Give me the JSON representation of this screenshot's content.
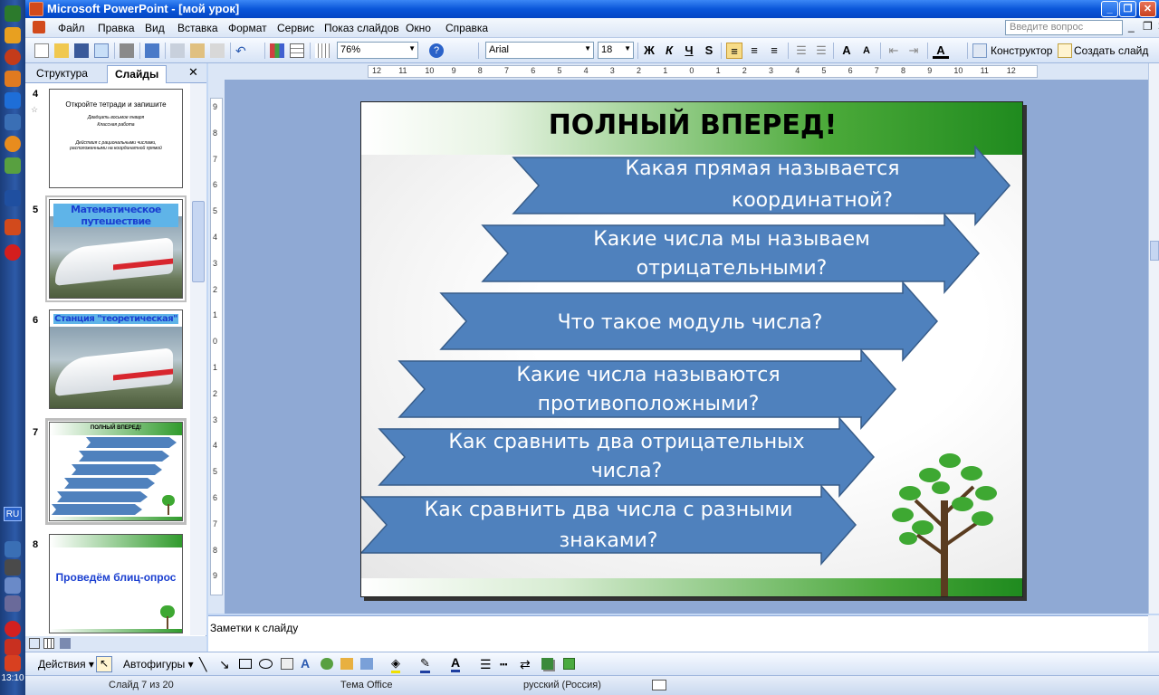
{
  "window": {
    "title": "Microsoft PowerPoint - [мой урок]"
  },
  "menu": {
    "items": [
      "Файл",
      "Правка",
      "Вид",
      "Вставка",
      "Формат",
      "Сервис",
      "Показ слайдов",
      "Окно",
      "Справка"
    ],
    "ask_placeholder": "Введите вопрос"
  },
  "toolbar": {
    "zoom": "76%",
    "font": "Arial",
    "font_size": "18",
    "bold": "Ж",
    "italic": "К",
    "underline": "Ч",
    "shadow": "S",
    "designer_label": "Конструктор",
    "new_slide_label": "Создать слайд"
  },
  "panel": {
    "tab_outline": "Структура",
    "tab_slides": "Слайды",
    "close": "✕",
    "slides": [
      {
        "num": "4",
        "title": "Откройте тетради и запишите",
        "lines": [
          "Двадцать восьмое января",
          "Классная работа",
          "Действия с рациональными числами, расположенными на координатной прямой"
        ]
      },
      {
        "num": "5",
        "wordart": "Математическое путешествие"
      },
      {
        "num": "6",
        "wordart": "Станция \"теоретическая\""
      },
      {
        "num": "7",
        "title": "ПОЛНЫЙ ВПЕРЕД!"
      },
      {
        "num": "8",
        "wordart": "Проведём блиц-опрос"
      }
    ]
  },
  "ruler": {
    "h_ticks": [
      "12",
      "11",
      "10",
      "9",
      "8",
      "7",
      "6",
      "5",
      "4",
      "3",
      "2",
      "1",
      "0",
      "1",
      "2",
      "3",
      "4",
      "5",
      "6",
      "7",
      "8",
      "9",
      "10",
      "11",
      "12"
    ],
    "v_ticks": [
      "9",
      "8",
      "7",
      "6",
      "5",
      "4",
      "3",
      "2",
      "1",
      "0",
      "1",
      "2",
      "3",
      "4",
      "5",
      "6",
      "7",
      "8",
      "9"
    ]
  },
  "slide": {
    "title": "ПОЛНЫЙ ВПЕРЕД!",
    "questions": [
      {
        "line1": "Какая прямая называется",
        "line2": "координатной?"
      },
      {
        "line1": "Какие числа мы называем",
        "line2": "отрицательными?"
      },
      {
        "line1": "Что такое модуль числа?",
        "line2": ""
      },
      {
        "line1": "Какие числа называются",
        "line2": "противоположными?"
      },
      {
        "line1": "Как сравнить два отрицательных",
        "line2": "числа?"
      },
      {
        "line1": "Как сравнить два числа с разными",
        "line2": "знаками?"
      }
    ],
    "colors": {
      "arrow": "#4f81bd",
      "arrow_border": "#385d8a",
      "green": "#2e9a2a"
    }
  },
  "notes": {
    "placeholder": "Заметки к слайду"
  },
  "drawbar": {
    "actions": "Действия",
    "autoshapes": "Автофигуры"
  },
  "status": {
    "slide": "Слайд 7 из 20",
    "theme": "Тема Office",
    "language": "русский (Россия)"
  },
  "taskbar": {
    "lang": "RU",
    "clock": "13:10"
  }
}
